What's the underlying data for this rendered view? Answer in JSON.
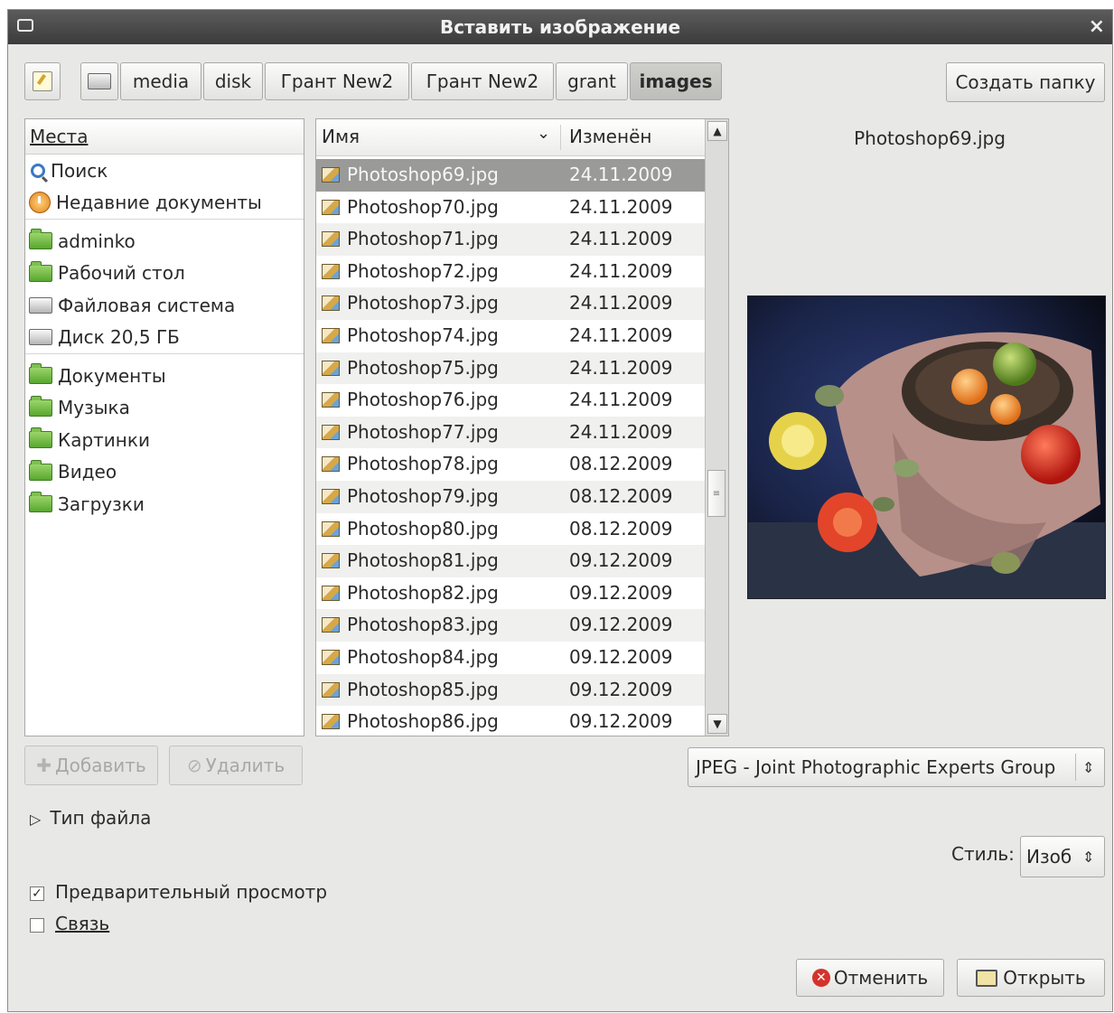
{
  "window": {
    "title": "Вставить изображение"
  },
  "pathbar": {
    "segments": [
      "media",
      "disk",
      "Грант New2",
      "Грант New2",
      "grant",
      "images"
    ],
    "create_folder": "Создать папку"
  },
  "places": {
    "header": "Места",
    "items": [
      {
        "label": "Поиск",
        "icon": "search-icon"
      },
      {
        "label": "Недавние документы",
        "icon": "recent-icon"
      },
      {
        "label": "adminko",
        "icon": "folder-icon"
      },
      {
        "label": "Рабочий стол",
        "icon": "folder-icon"
      },
      {
        "label": "Файловая система",
        "icon": "drive-icon"
      },
      {
        "label": "Диск 20,5 ГБ",
        "icon": "drive-icon"
      },
      {
        "label": "Документы",
        "icon": "folder-icon"
      },
      {
        "label": "Музыка",
        "icon": "folder-icon"
      },
      {
        "label": "Картинки",
        "icon": "folder-icon"
      },
      {
        "label": "Видео",
        "icon": "folder-icon"
      },
      {
        "label": "Загрузки",
        "icon": "folder-icon"
      }
    ],
    "add_button": "Добавить",
    "remove_button": "Удалить"
  },
  "files": {
    "col_name": "Имя",
    "col_modified": "Изменён",
    "rows": [
      {
        "name": "Photoshop69.jpg",
        "date": "24.11.2009"
      },
      {
        "name": "Photoshop70.jpg",
        "date": "24.11.2009"
      },
      {
        "name": "Photoshop71.jpg",
        "date": "24.11.2009"
      },
      {
        "name": "Photoshop72.jpg",
        "date": "24.11.2009"
      },
      {
        "name": "Photoshop73.jpg",
        "date": "24.11.2009"
      },
      {
        "name": "Photoshop74.jpg",
        "date": "24.11.2009"
      },
      {
        "name": "Photoshop75.jpg",
        "date": "24.11.2009"
      },
      {
        "name": "Photoshop76.jpg",
        "date": "24.11.2009"
      },
      {
        "name": "Photoshop77.jpg",
        "date": "24.11.2009"
      },
      {
        "name": "Photoshop78.jpg",
        "date": "08.12.2009"
      },
      {
        "name": "Photoshop79.jpg",
        "date": "08.12.2009"
      },
      {
        "name": "Photoshop80.jpg",
        "date": "08.12.2009"
      },
      {
        "name": "Photoshop81.jpg",
        "date": "09.12.2009"
      },
      {
        "name": "Photoshop82.jpg",
        "date": "09.12.2009"
      },
      {
        "name": "Photoshop83.jpg",
        "date": "09.12.2009"
      },
      {
        "name": "Photoshop84.jpg",
        "date": "09.12.2009"
      },
      {
        "name": "Photoshop85.jpg",
        "date": "09.12.2009"
      },
      {
        "name": "Photoshop86.jpg",
        "date": "09.12.2009"
      }
    ]
  },
  "preview": {
    "filename": "Photoshop69.jpg"
  },
  "filter": {
    "selected": "JPEG - Joint Photographic Experts Group"
  },
  "filetype_expander": "Тип файла",
  "style": {
    "label": "Стиль:",
    "value": "Изоб"
  },
  "options": {
    "preview_label": "Предварительный просмотр",
    "preview_checked": true,
    "link_label": "Связь",
    "link_checked": false
  },
  "actions": {
    "cancel": "Отменить",
    "open": "Открыть"
  },
  "colors": {
    "titlebar": "#3b3b3b",
    "selection": "#9a9a98",
    "cancel_icon": "#d4322b",
    "folder": "#58a72f"
  }
}
